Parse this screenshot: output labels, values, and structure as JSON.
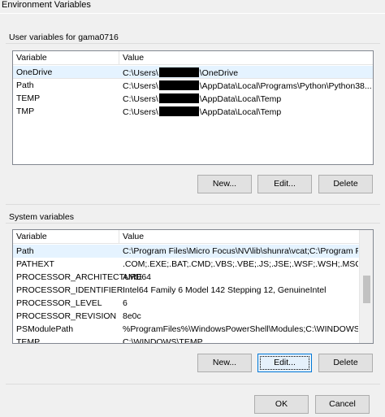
{
  "window": {
    "title": "Environment Variables"
  },
  "user_vars": {
    "group_label": "User variables for gama0716",
    "columns": [
      "Variable",
      "Value"
    ],
    "rows": [
      {
        "variable": "OneDrive",
        "value_prefix": "C:\\Users\\",
        "value_suffix": "\\OneDrive",
        "redacted": true
      },
      {
        "variable": "Path",
        "value_prefix": "C:\\Users\\",
        "value_suffix": "\\AppData\\Local\\Programs\\Python\\Python38...",
        "redacted": true
      },
      {
        "variable": "TEMP",
        "value_prefix": "C:\\Users\\",
        "value_suffix": "\\AppData\\Local\\Temp",
        "redacted": true
      },
      {
        "variable": "TMP",
        "value_prefix": "C:\\Users\\",
        "value_suffix": "\\AppData\\Local\\Temp",
        "redacted": true
      }
    ],
    "buttons": {
      "new": "New...",
      "edit": "Edit...",
      "delete": "Delete"
    }
  },
  "system_vars": {
    "group_label": "System variables",
    "columns": [
      "Variable",
      "Value"
    ],
    "rows": [
      {
        "variable": "Path",
        "value": "C:\\Program Files\\Micro Focus\\NV\\lib\\shunra\\vcat;C:\\Program File..."
      },
      {
        "variable": "PATHEXT",
        "value": ".COM;.EXE;.BAT;.CMD;.VBS;.VBE;.JS;.JSE;.WSF;.WSH;.MSC"
      },
      {
        "variable": "PROCESSOR_ARCHITECTURE",
        "value": "AMD64"
      },
      {
        "variable": "PROCESSOR_IDENTIFIER",
        "value": "Intel64 Family 6 Model 142 Stepping 12, GenuineIntel"
      },
      {
        "variable": "PROCESSOR_LEVEL",
        "value": "6"
      },
      {
        "variable": "PROCESSOR_REVISION",
        "value": "8e0c"
      },
      {
        "variable": "PSModulePath",
        "value": "%ProgramFiles%\\WindowsPowerShell\\Modules;C:\\WINDOWS\\sy..."
      },
      {
        "variable": "TEMP",
        "value": "C:\\WINDOWS\\TEMP"
      }
    ],
    "buttons": {
      "new": "New...",
      "edit": "Edit...",
      "delete": "Delete"
    }
  },
  "dialog_buttons": {
    "ok": "OK",
    "cancel": "Cancel"
  }
}
